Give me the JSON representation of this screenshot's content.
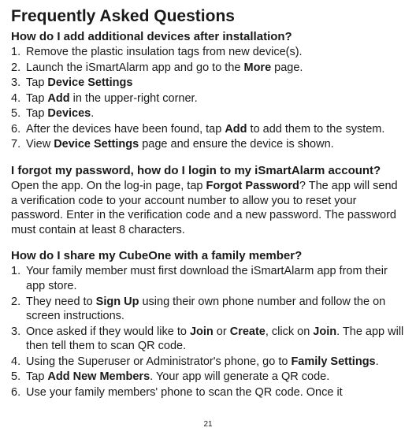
{
  "title": "Frequently Asked Questions",
  "q1": {
    "question": "How do I add additional devices after installation?",
    "steps": [
      {
        "pre": "Remove the plastic insulation tags from new device(s)."
      },
      {
        "pre": "Launch the iSmartAlarm app and go to the ",
        "b1": "More",
        "post": " page."
      },
      {
        "pre": "Tap ",
        "b1": "Device Settings"
      },
      {
        "pre": "Tap ",
        "b1": "Add",
        "post": " in the upper-right corner."
      },
      {
        "pre": "Tap ",
        "b1": "Devices",
        "post": "."
      },
      {
        "pre": "After the devices have been found, tap ",
        "b1": "Add",
        "post": " to add them to the system."
      },
      {
        "pre": "View ",
        "b1": "Device Settings",
        "post": " page and ensure the device is shown."
      }
    ]
  },
  "q2": {
    "question": "I forgot my password, how do I login to my iSmartAlarm account?",
    "answer_pre": "Open the app. On the log-in page, tap ",
    "answer_bold": "Forgot Password",
    "answer_post": "? The app will send a verification code to your account number to allow you to reset your password. Enter in the verification code and a new password. The password must contain at least 8 characters."
  },
  "q3": {
    "question": "How do I share my CubeOne with a family member?",
    "steps": [
      {
        "pre": "Your family member must first download the iSmartAlarm app from their app store."
      },
      {
        "pre": "They need to ",
        "b1": "Sign Up",
        "post": " using their own phone number and follow the on screen instructions."
      },
      {
        "pre": "Once asked if they would like to ",
        "b1": "Join",
        "mid1": " or ",
        "b2": "Create",
        "mid2": ", click on ",
        "b3": "Join",
        "post": ". The app will then tell them to scan QR code."
      },
      {
        "pre": "Using the Superuser or Administrator's phone, go to ",
        "b1": "Family Settings",
        "post": "."
      },
      {
        "pre": "Tap ",
        "b1": "Add New Members",
        "post": ". Your app will generate a QR code."
      },
      {
        "pre": "Use your family members' phone to scan the QR code. Once it"
      }
    ]
  },
  "page_number": "21"
}
